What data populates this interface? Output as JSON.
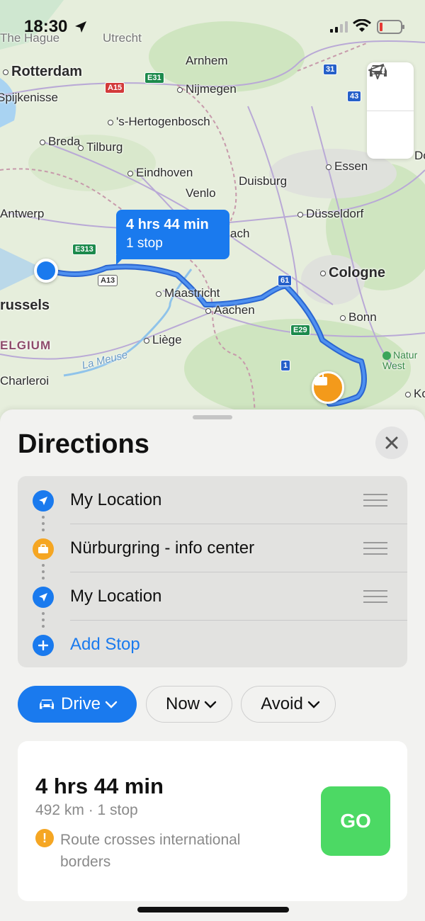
{
  "status": {
    "time": "18:30"
  },
  "map": {
    "labels": {
      "the_hague": "The Hague",
      "utrecht": "Utrecht",
      "rotterdam": "Rotterdam",
      "spijkenisse": "Spijkenisse",
      "arnhem": "Arnhem",
      "nijmegen": "Nijmegen",
      "hertogenbosch": "'s-Hertogenbosch",
      "breda": "Breda",
      "tilburg": "Tilburg",
      "eindhoven": "Eindhoven",
      "essen": "Essen",
      "dortmund": "Dort",
      "venlo": "Venlo",
      "duisburg": "Duisburg",
      "antwerp": "Antwerp",
      "dusseldorf": "Düsseldorf",
      "aachen_partial": "ach",
      "cologne": "Cologne",
      "brussels": "russels",
      "maastricht": "Maastricht",
      "aachen": "Aachen",
      "bonn": "Bonn",
      "belgium": "ELGIUM",
      "liege": "Liège",
      "river_meuse": "La Meuse",
      "nature_west": "Natur West",
      "charleroi": "Charleroi",
      "koblenz": "Ko"
    },
    "shields": {
      "a15": "A15",
      "e31": "E31",
      "r31": "31",
      "r43": "43",
      "e313": "E313",
      "a13": "A13",
      "r61": "61",
      "e29": "E29",
      "r1": "1"
    },
    "callout": {
      "duration": "4 hrs 44 min",
      "stops": "1 stop"
    },
    "colors": {
      "route": "#3a7ee6",
      "pin": "#f39a1b"
    }
  },
  "sheet": {
    "title": "Directions",
    "waypoints": [
      {
        "label": "My Location",
        "icon": "location-arrow-icon"
      },
      {
        "label": "Nürburgring - info center",
        "icon": "briefcase-icon"
      },
      {
        "label": "My Location",
        "icon": "location-arrow-icon"
      }
    ],
    "add_stop": "Add Stop",
    "chips": {
      "drive": "Drive",
      "now": "Now",
      "avoid": "Avoid"
    },
    "route": {
      "duration": "4 hrs 44 min",
      "summary": "492 km · 1 stop",
      "warning": "Route crosses international borders",
      "warning_icon": "!",
      "go": "GO"
    }
  }
}
